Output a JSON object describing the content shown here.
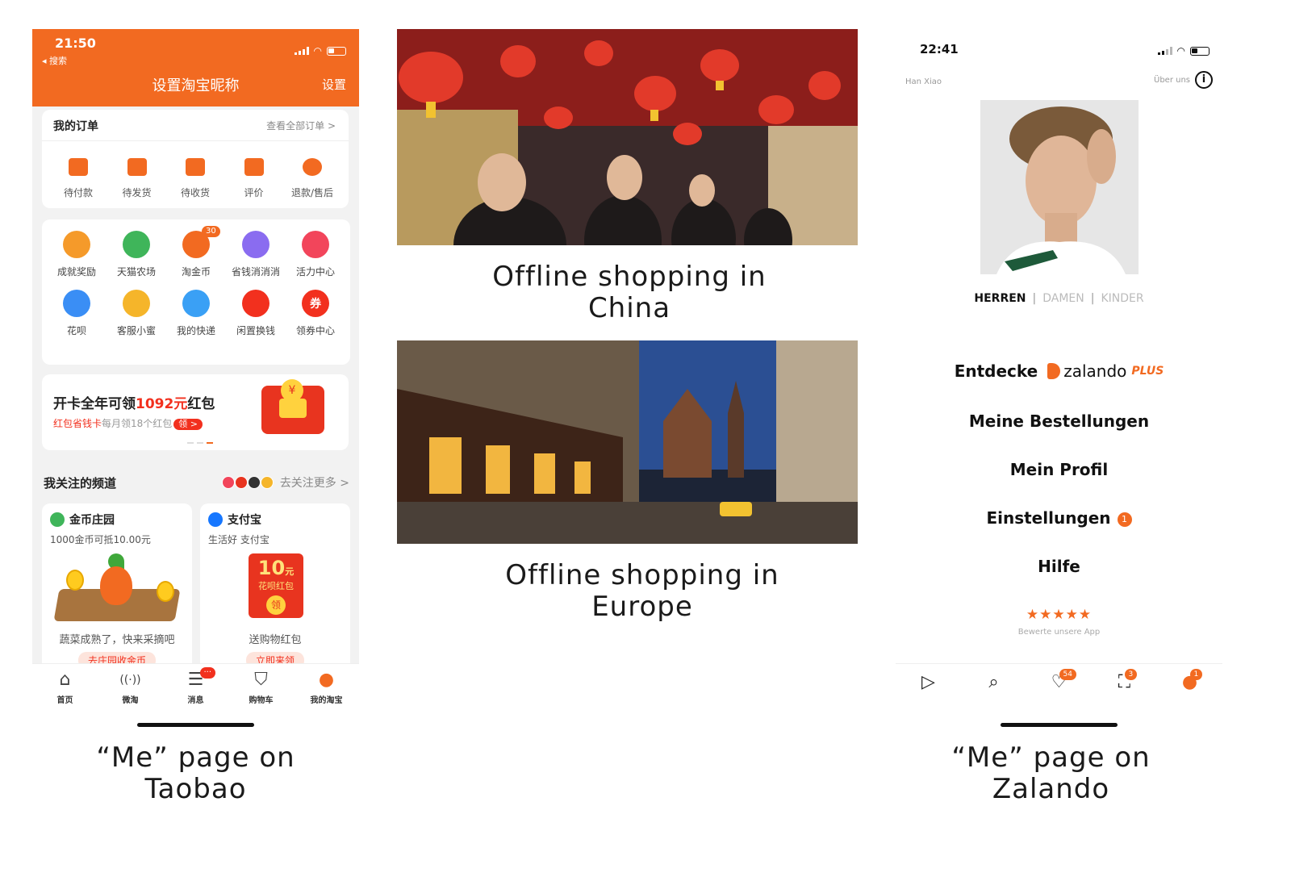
{
  "colors": {
    "taobao_orange": "#f26a21",
    "red": "#f2301e",
    "zalando_orange": "#f26a21"
  },
  "captions": {
    "china": "Offline shopping in China",
    "europe": "Offline shopping in Europe",
    "taobao": "“Me” page on Taobao",
    "zalando": "“Me” page on Zalando"
  },
  "taobao": {
    "status_time": "21:50",
    "back_label": "◂ 搜索",
    "title": "设置淘宝昵称",
    "settings": "设置",
    "orders": {
      "title": "我的订单",
      "view_all": "查看全部订单 >",
      "items": [
        {
          "label": "待付款",
          "icon": "wallet-icon"
        },
        {
          "label": "待发货",
          "icon": "package-icon"
        },
        {
          "label": "待收货",
          "icon": "truck-icon"
        },
        {
          "label": "评价",
          "icon": "comment-icon"
        },
        {
          "label": "退款/售后",
          "icon": "refund-icon"
        }
      ]
    },
    "tools": [
      {
        "label": "成就奖励",
        "icon": "trophy-icon",
        "color": "#f59a2a"
      },
      {
        "label": "天猫农场",
        "icon": "farm-icon",
        "color": "#3fb55a"
      },
      {
        "label": "淘金币",
        "icon": "coin-icon",
        "color": "#f26a21",
        "badge": "30"
      },
      {
        "label": "省钱消消消",
        "icon": "game-icon",
        "color": "#8a6cf0"
      },
      {
        "label": "活力中心",
        "icon": "medal-icon",
        "color": "#f2455b"
      },
      {
        "label": "花呗",
        "icon": "huabei-icon",
        "color": "#3a8ef5"
      },
      {
        "label": "客服小蜜",
        "icon": "service-icon",
        "color": "#f5b52a"
      },
      {
        "label": "我的快递",
        "icon": "delivery-icon",
        "color": "#3aa0f5"
      },
      {
        "label": "闲置换钱",
        "icon": "money-bag-icon",
        "color": "#f2301e"
      },
      {
        "label": "领券中心",
        "icon": "coupon-icon",
        "color": "#f2301e",
        "glyph": "券"
      }
    ],
    "banner": {
      "title_pre": "开卡全年可领",
      "title_amount": "1092元",
      "title_post": "红包",
      "sub_red": "红包省钱卡",
      "sub_gray": "每月领18个红包",
      "sub_button": "领 >",
      "yen": "¥"
    },
    "channels": {
      "title": "我关注的频道",
      "more": "去关注更多 >",
      "cards": [
        {
          "name": "金币庄园",
          "sub": "1000金币可抵10.00元",
          "footer": "蔬菜成熟了，快来采摘吧",
          "button": "去庄园收金币"
        },
        {
          "name": "支付宝",
          "sub": "生活好 支付宝",
          "footer": "送购物红包",
          "button": "立即来领",
          "amount": "10",
          "unit": "元",
          "red_label": "花呗红包",
          "claim": "领"
        }
      ]
    },
    "tabs": [
      {
        "label": "首页",
        "icon": "home-icon",
        "glyph": "⌂"
      },
      {
        "label": "微淘",
        "icon": "broadcast-icon",
        "glyph": "((·))"
      },
      {
        "label": "消息",
        "icon": "message-icon",
        "glyph": "☰",
        "badge": "···"
      },
      {
        "label": "购物车",
        "icon": "cart-icon",
        "glyph": "⛉"
      },
      {
        "label": "我的淘宝",
        "icon": "person-icon",
        "glyph": "●",
        "active": true
      }
    ]
  },
  "zalando": {
    "status_time": "22:41",
    "user_name": "Han Xiao",
    "about": "Über uns",
    "info_glyph": "i",
    "gender": {
      "men": "HERREN",
      "separator": "|",
      "women": "DAMEN",
      "kids": "KINDER"
    },
    "menu": {
      "discover": "Entdecke",
      "brand": "zalando",
      "brand_plus": "PLUS",
      "orders": "Meine Bestellungen",
      "profile": "Mein Profil",
      "settings": "Einstellungen",
      "settings_badge": "1",
      "help": "Hilfe"
    },
    "stars": "★★★★★",
    "rate_app": "Bewerte unsere App",
    "tabs": [
      {
        "icon": "zalando-home-icon",
        "glyph": "▷"
      },
      {
        "icon": "search-list-icon",
        "glyph": "⌕"
      },
      {
        "icon": "heart-icon",
        "glyph": "♡",
        "badge": "54"
      },
      {
        "icon": "bag-icon",
        "glyph": "⛶",
        "badge": "3"
      },
      {
        "icon": "profile-icon",
        "glyph": "●",
        "badge": "1",
        "active": true
      }
    ]
  }
}
